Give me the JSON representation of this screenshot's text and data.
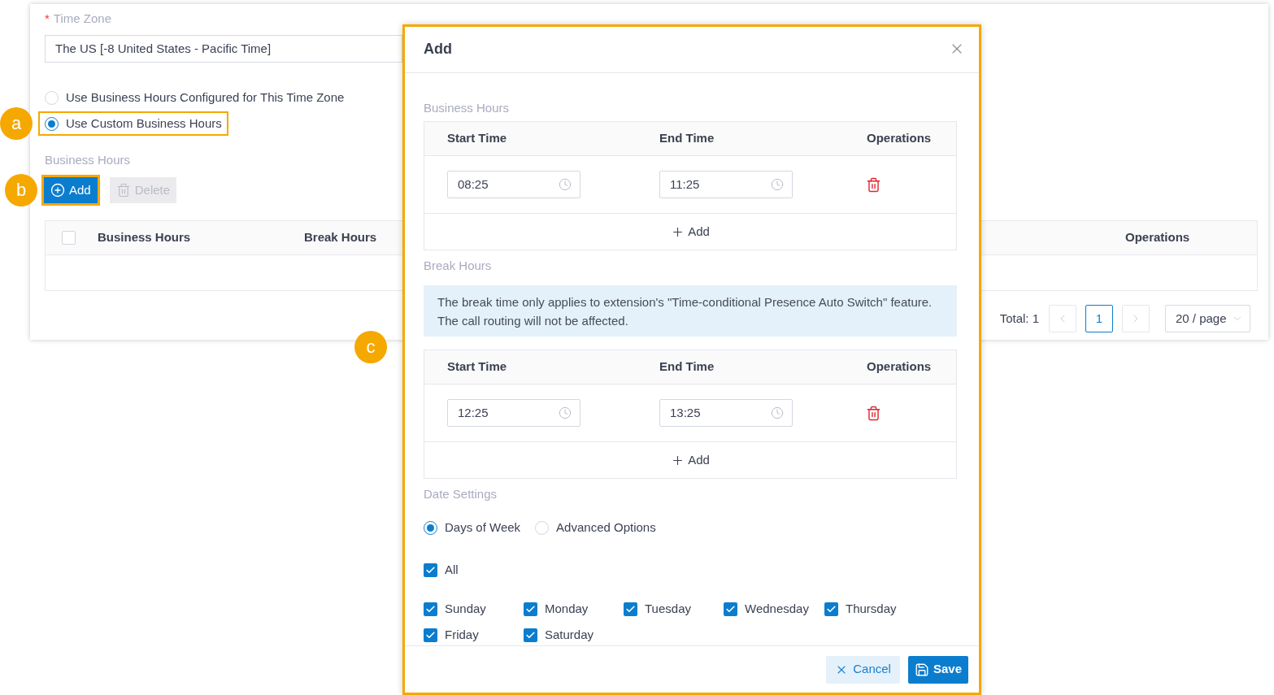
{
  "page": {
    "time_zone": {
      "required_mark": "*",
      "label": "Time Zone",
      "value": "The US [-8 United States - Pacific Time]"
    },
    "hours_source": [
      {
        "label": "Use Business Hours Configured for This Time Zone",
        "selected": false,
        "highlighted": false
      },
      {
        "label": "Use Custom Business Hours",
        "selected": true,
        "highlighted": true,
        "callout": "a"
      }
    ],
    "section_label": "Business Hours",
    "toolbar": [
      {
        "kind": "add",
        "label": "Add",
        "disabled": false,
        "highlighted": true,
        "callout": "b"
      },
      {
        "kind": "delete",
        "label": "Delete",
        "disabled": true,
        "highlighted": false
      }
    ],
    "table": {
      "select_all_checked": false,
      "columns": [
        "Business Hours",
        "Break Hours",
        "Operations"
      ]
    },
    "pagination": {
      "total": "Total: 1",
      "pages": [
        {
          "label": "1",
          "selected": true
        }
      ],
      "page_size": "20 / page"
    }
  },
  "dialog": {
    "highlighted": true,
    "callout": "c",
    "title": "Add",
    "business_hours": {
      "label": "Business Hours",
      "columns": [
        "Start Time",
        "End Time",
        "Operations"
      ],
      "rows": [
        {
          "start": "08:25",
          "end": "11:25"
        }
      ],
      "add_label": "Add"
    },
    "break_hours": {
      "label": "Break Hours",
      "notice": "The break time only applies to extension's \"Time-conditional Presence Auto Switch\" feature. The call routing will not be affected.",
      "columns": [
        "Start Time",
        "End Time",
        "Operations"
      ],
      "rows": [
        {
          "start": "12:25",
          "end": "13:25"
        }
      ],
      "add_label": "Add"
    },
    "date_settings": {
      "label": "Date Settings",
      "modes": [
        {
          "label": "Days of Week",
          "selected": true
        },
        {
          "label": "Advanced Options",
          "selected": false
        }
      ],
      "all": {
        "label": "All",
        "checked": true
      },
      "days": [
        {
          "label": "Sunday",
          "checked": true
        },
        {
          "label": "Monday",
          "checked": true
        },
        {
          "label": "Tuesday",
          "checked": true
        },
        {
          "label": "Wednesday",
          "checked": true
        },
        {
          "label": "Thursday",
          "checked": true
        },
        {
          "label": "Friday",
          "checked": true
        },
        {
          "label": "Saturday",
          "checked": true
        }
      ]
    },
    "buttons": [
      {
        "kind": "cancel",
        "label": "Cancel"
      },
      {
        "kind": "save",
        "label": "Save"
      }
    ]
  }
}
